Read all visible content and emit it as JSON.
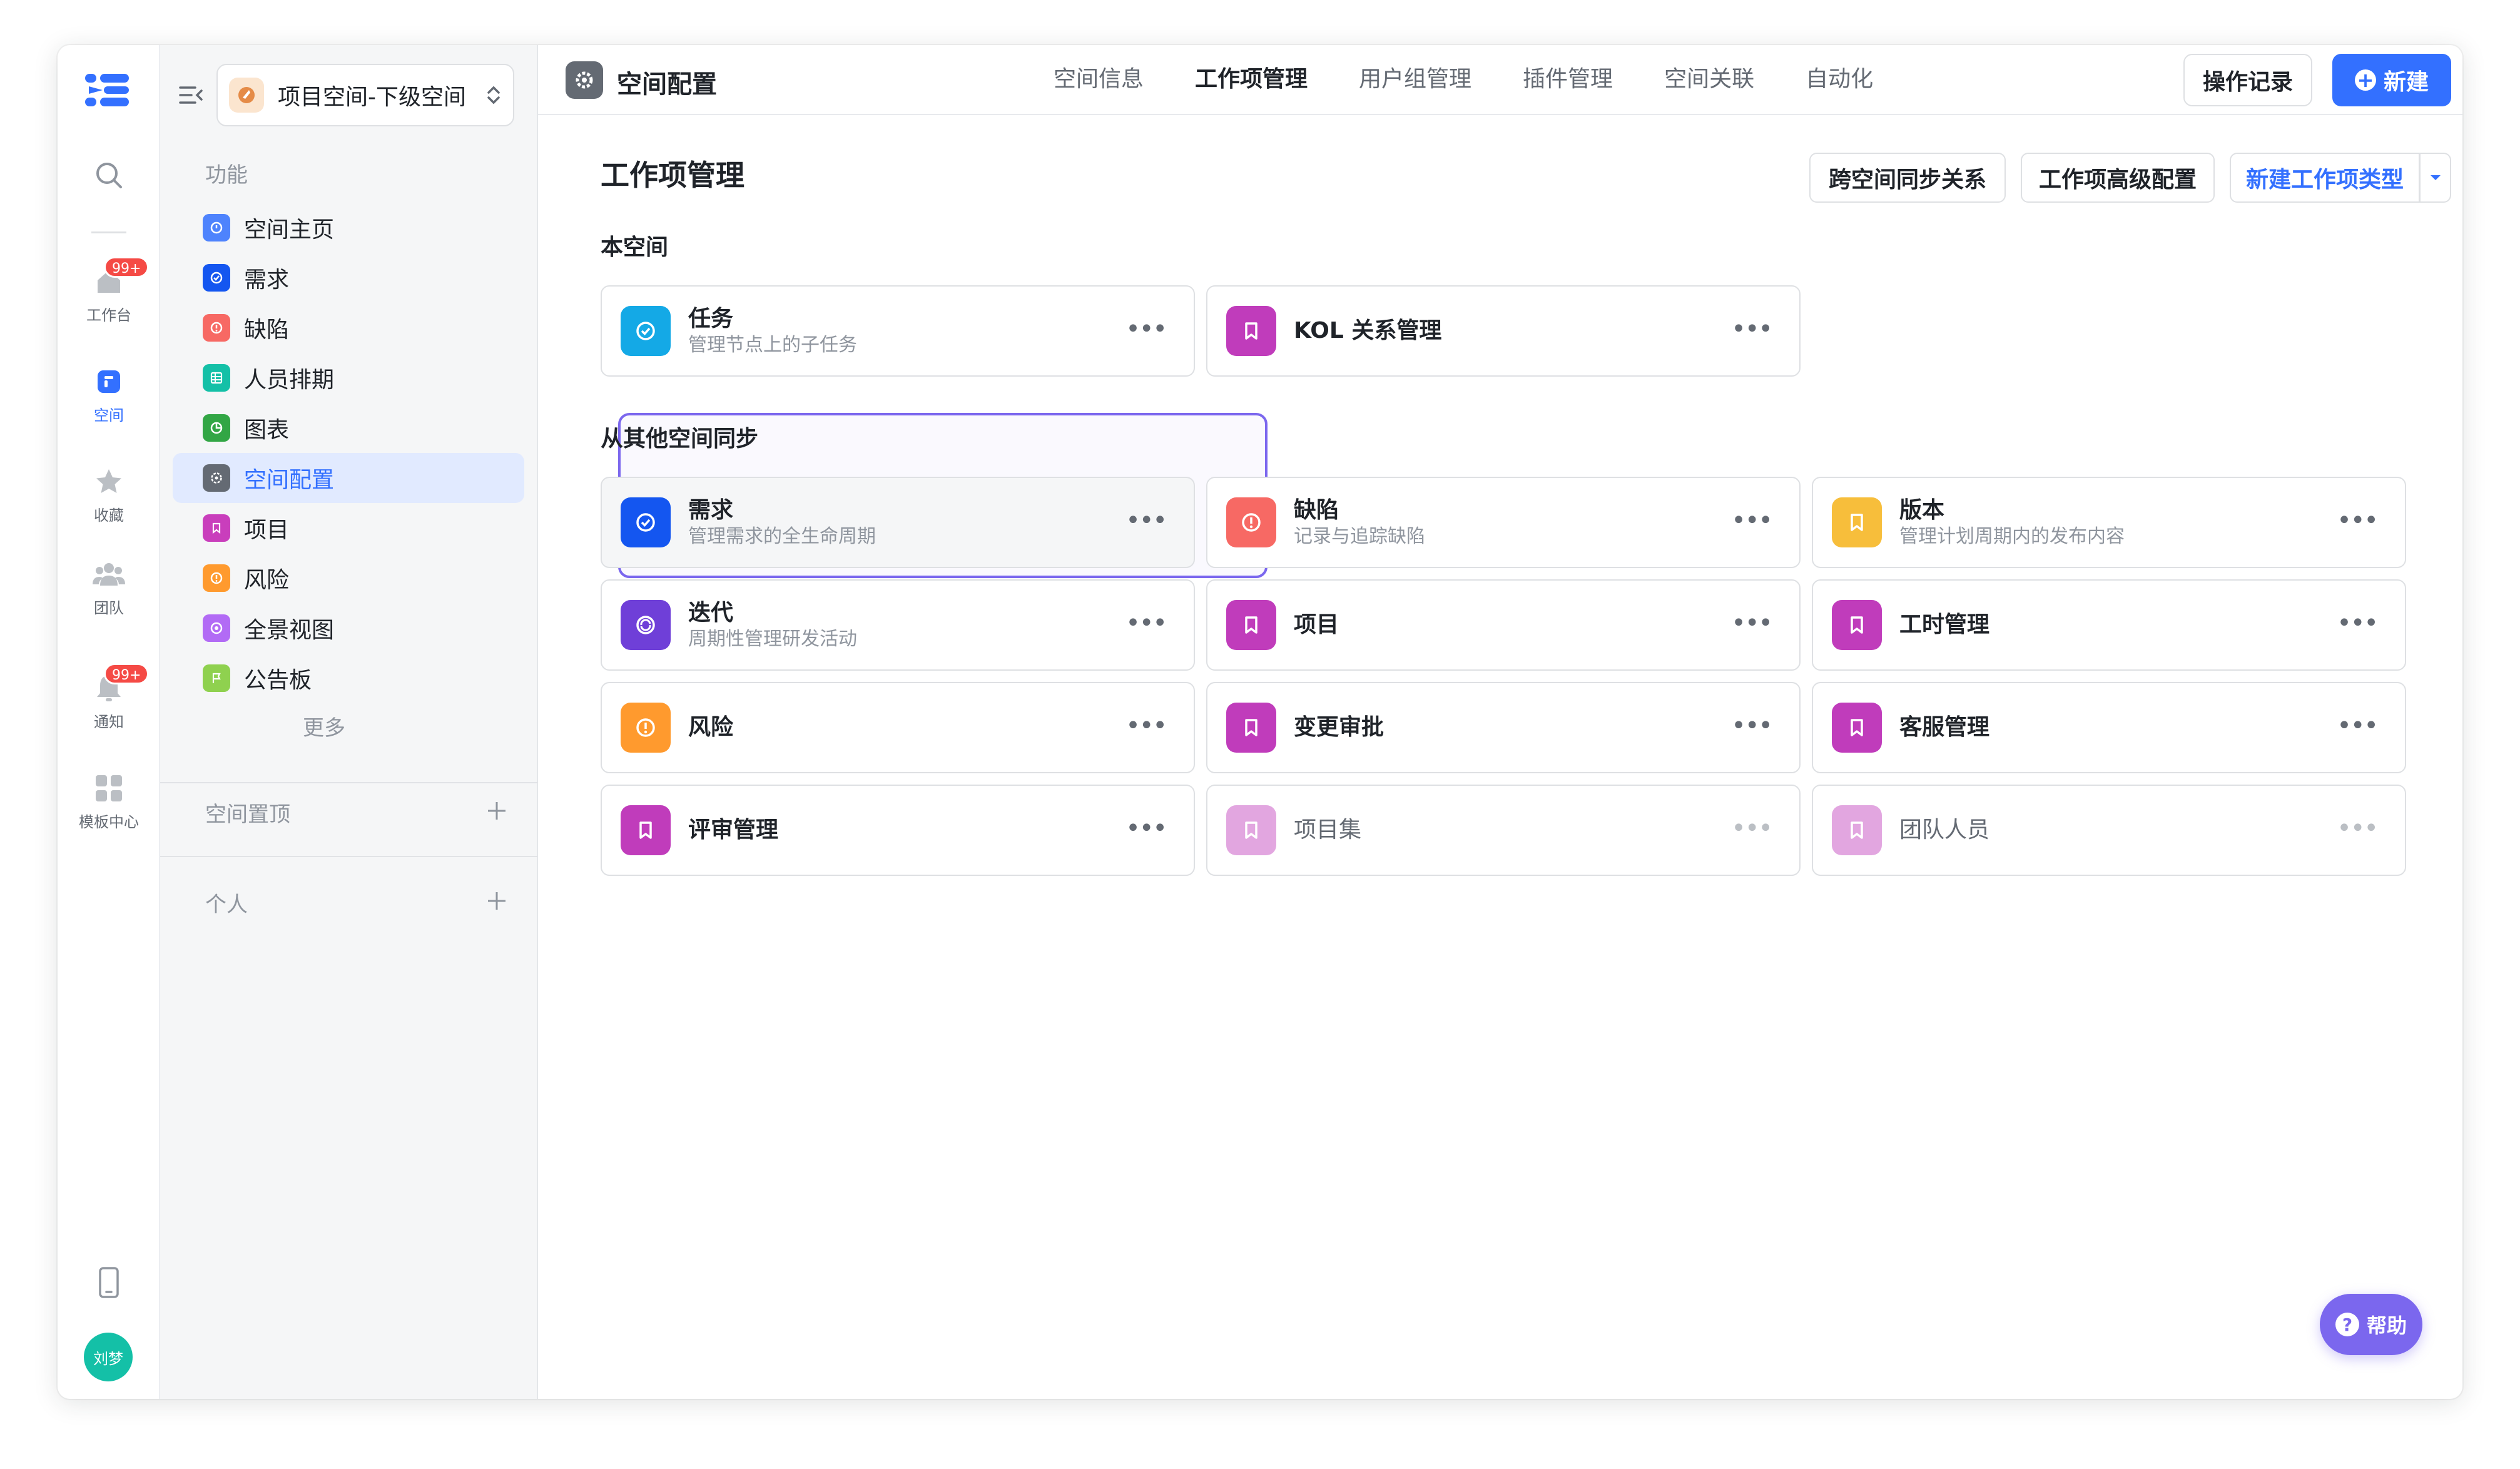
{
  "rail": {
    "items": [
      {
        "label": "工作台",
        "badge": "99+",
        "icon": "workbench-icon"
      },
      {
        "label": "空间",
        "icon": "space-icon"
      },
      {
        "label": "收藏",
        "icon": "star-icon"
      },
      {
        "label": "团队",
        "icon": "team-icon"
      },
      {
        "label": "通知",
        "badge": "99+",
        "icon": "bell-icon"
      },
      {
        "label": "模板中心",
        "icon": "template-icon"
      }
    ],
    "avatar": "刘梦"
  },
  "sidebar": {
    "space_name": "项目空间-下级空间",
    "section_features": "功能",
    "items": [
      {
        "label": "空间主页",
        "color": "#4e83fd"
      },
      {
        "label": "需求",
        "color": "#1456f0"
      },
      {
        "label": "缺陷",
        "color": "#f76964"
      },
      {
        "label": "人员排期",
        "color": "#14c0a7"
      },
      {
        "label": "图表",
        "color": "#32a645"
      },
      {
        "label": "空间配置",
        "color": "#646a73"
      },
      {
        "label": "项目",
        "color": "#c93ebc"
      },
      {
        "label": "风险",
        "color": "#ff9a2e"
      },
      {
        "label": "全景视图",
        "color": "#b26bf5"
      },
      {
        "label": "公告板",
        "color": "#8fd14f"
      }
    ],
    "more": "更多",
    "pinned": "空间置顶",
    "personal": "个人"
  },
  "header": {
    "title": "空间配置",
    "tabs": [
      "空间信息",
      "工作项管理",
      "用户组管理",
      "插件管理",
      "空间关联",
      "自动化"
    ],
    "active_tab": "工作项管理",
    "log_button": "操作记录",
    "new_button": "新建"
  },
  "main": {
    "title": "工作项管理",
    "actions": {
      "cross_sync": "跨空间同步关系",
      "advanced": "工作项高级配置",
      "new_type": "新建工作项类型"
    },
    "section_this": "本空间",
    "section_sync": "从其他空间同步",
    "this_space_cards": [
      {
        "name": "任务",
        "desc": "管理节点上的子任务",
        "color": "#14a9e6",
        "icon": "check-circle-icon"
      },
      {
        "name": "KOL 关系管理",
        "desc": "",
        "color": "#c03cbb",
        "icon": "bookmark-icon"
      }
    ],
    "sync_cards": [
      {
        "name": "需求",
        "desc": "管理需求的全生命周期",
        "color": "#1456f0",
        "icon": "check-circle-icon"
      },
      {
        "name": "缺陷",
        "desc": "记录与追踪缺陷",
        "color": "#f76964",
        "icon": "alert-icon"
      },
      {
        "name": "版本",
        "desc": "管理计划周期内的发布内容",
        "color": "#f7be3b",
        "icon": "bookmark-icon"
      },
      {
        "name": "迭代",
        "desc": "周期性管理研发活动",
        "color": "#6f3fd8",
        "icon": "cycle-icon"
      },
      {
        "name": "项目",
        "desc": "",
        "color": "#c03cbb",
        "icon": "bookmark-icon"
      },
      {
        "name": "工时管理",
        "desc": "",
        "color": "#c03cbb",
        "icon": "bookmark-icon"
      },
      {
        "name": "风险",
        "desc": "",
        "color": "#ff9a2e",
        "icon": "alert-icon"
      },
      {
        "name": "变更审批",
        "desc": "",
        "color": "#c03cbb",
        "icon": "bookmark-icon"
      },
      {
        "name": "客服管理",
        "desc": "",
        "color": "#c03cbb",
        "icon": "bookmark-icon"
      },
      {
        "name": "评审管理",
        "desc": "",
        "color": "#c03cbb",
        "icon": "bookmark-icon"
      },
      {
        "name": "项目集",
        "desc": "",
        "color": "#c03cbb",
        "icon": "bookmark-icon",
        "disabled": true
      },
      {
        "name": "团队人员",
        "desc": "",
        "color": "#c03cbb",
        "icon": "bookmark-icon",
        "disabled": true
      }
    ]
  },
  "help": "帮助"
}
